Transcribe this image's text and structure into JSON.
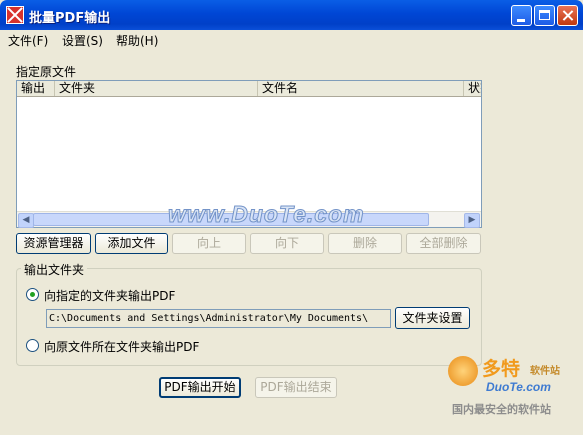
{
  "window": {
    "title": "批量PDF输出"
  },
  "menu": {
    "file": "文件(F)",
    "settings": "设置(S)",
    "help": "帮助(H)"
  },
  "source_section": {
    "label": "指定原文件"
  },
  "file_list": {
    "columns": [
      "输出",
      "文件夹",
      "文件名",
      "状态"
    ],
    "rows": []
  },
  "list_buttons": {
    "explorer": "资源管理器",
    "add_file": "添加文件",
    "up": "向上",
    "down": "向下",
    "delete": "删除",
    "delete_all": "全部删除"
  },
  "output_group": {
    "title": "输出文件夹",
    "option_specified": "向指定的文件夹输出PDF",
    "folder_path": "C:\\Documents and Settings\\Administrator\\My Documents\\",
    "folder_settings_button": "文件夹设置",
    "option_original": "向原文件所在文件夹输出PDF",
    "selected_option": "specified"
  },
  "actions": {
    "start": "PDF输出开始",
    "stop": "PDF输出结束"
  },
  "watermark": {
    "text": "www.DuoTe.com"
  },
  "logo": {
    "main": "多特",
    "sub": "软件站",
    "en": "DuoTe.com",
    "tagline": "国内最安全的软件站"
  },
  "colors": {
    "title_bar": "#0046d5",
    "window_bg": "#ece9d8",
    "radio_check": "#21a121"
  }
}
